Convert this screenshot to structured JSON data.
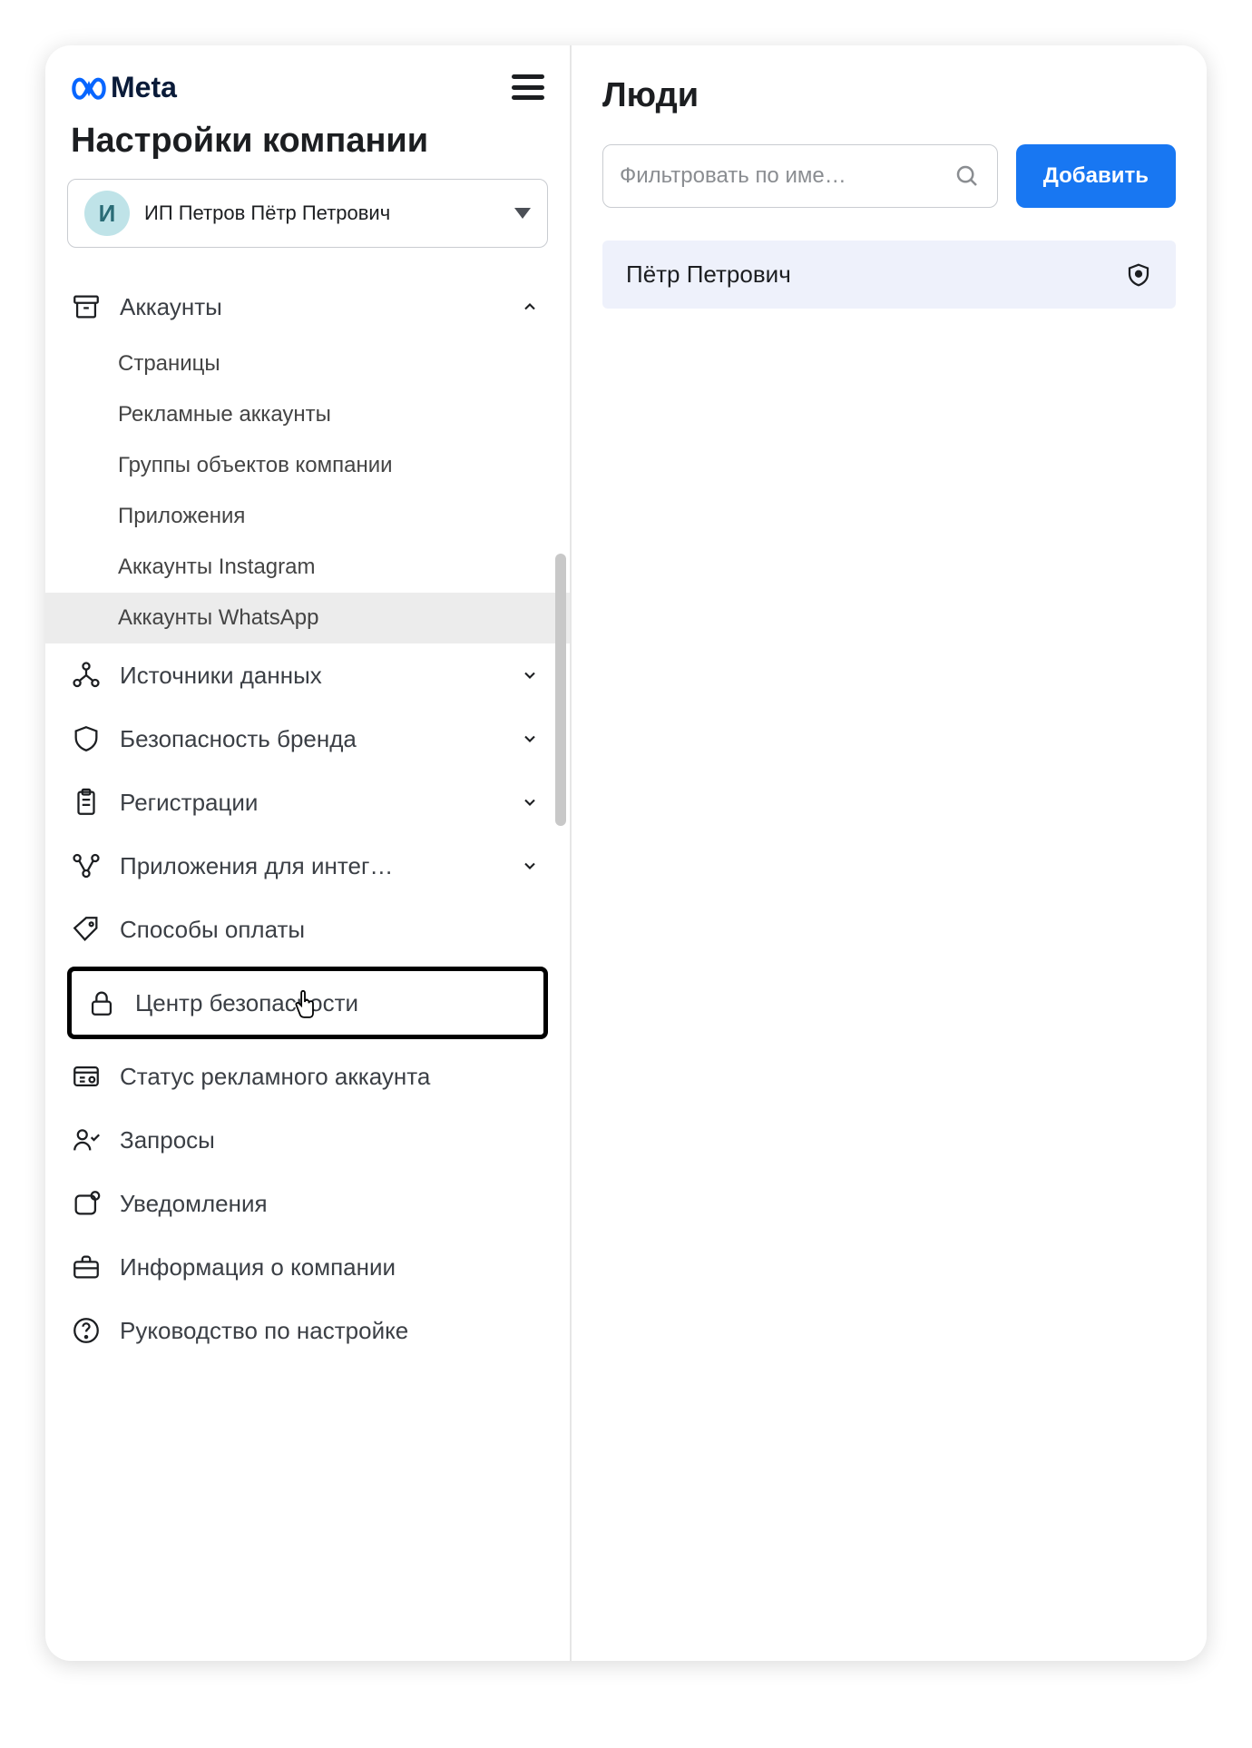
{
  "brand": "Meta",
  "sidebar": {
    "title": "Настройки компании",
    "account": {
      "initial": "И",
      "name": "ИП Петров Пётр Петрович"
    },
    "sections": {
      "accounts": {
        "label": "Аккаунты",
        "children": [
          "Страницы",
          "Рекламные аккаунты",
          "Группы объектов компании",
          "Приложения",
          "Аккаунты Instagram",
          "Аккаунты WhatsApp"
        ]
      },
      "data_sources": {
        "label": "Источники данных"
      },
      "brand_safety": {
        "label": "Безопасность бренда"
      },
      "registrations": {
        "label": "Регистрации"
      },
      "integrations": {
        "label": "Приложения для интег…"
      },
      "payments": {
        "label": "Способы оплаты"
      },
      "security": {
        "label": "Центр безопасности"
      },
      "ad_status": {
        "label": "Статус рекламного аккаунта"
      },
      "requests": {
        "label": "Запросы"
      },
      "notifications": {
        "label": "Уведомления"
      },
      "company_info": {
        "label": "Информация о компании"
      },
      "setup_guide": {
        "label": "Руководство по настройке"
      }
    }
  },
  "main": {
    "title": "Люди",
    "search_placeholder": "Фильтровать по име…",
    "add_button": "Добавить",
    "people": [
      {
        "name": "Пётр Петрович"
      }
    ]
  }
}
